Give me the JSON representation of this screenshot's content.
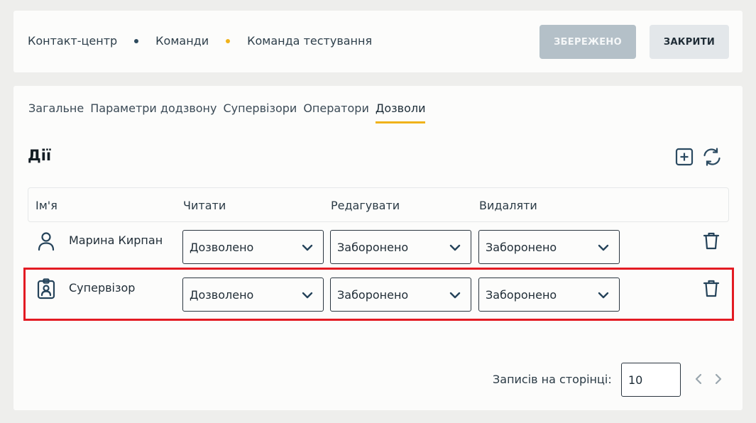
{
  "header": {
    "breadcrumb": [
      "Контакт-центр",
      "Команди",
      "Команда тестування"
    ],
    "save_label": "ЗБЕРЕЖЕНО",
    "close_label": "ЗАКРИТИ"
  },
  "tabs": [
    "Загальне",
    "Параметри додзвону",
    "Супервізори",
    "Оператори",
    "Дозволи"
  ],
  "active_tab": "Дозволи",
  "section": {
    "title": "Дії"
  },
  "table": {
    "columns": [
      "Ім'я",
      "Читати",
      "Редагувати",
      "Видаляти"
    ],
    "rows": [
      {
        "icon": "user-icon",
        "name": "Марина Кирпан",
        "read": "Дозволено",
        "edit": "Заборонено",
        "delete": "Заборонено"
      },
      {
        "icon": "badge-icon",
        "name": "Супервізор",
        "read": "Дозволено",
        "edit": "Заборонено",
        "delete": "Заборонено"
      }
    ]
  },
  "pagination": {
    "per_page_label": "Записів на сторінці:",
    "per_page_value": "10"
  },
  "colors": {
    "accent": "#f0b21a",
    "highlight": "#e31b23",
    "icon": "#25435a"
  }
}
